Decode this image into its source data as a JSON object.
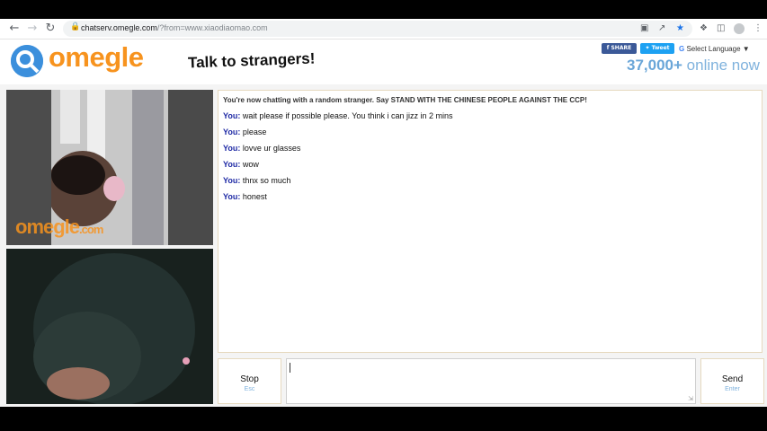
{
  "browser": {
    "url_host": "chatserv.omegle.com",
    "url_rest": "/?from=www.xiaodiaomao.com",
    "icons": {
      "back": "arrow-left-icon",
      "forward": "arrow-right-icon",
      "reload": "reload-icon",
      "lock": "lock-icon",
      "camera": "camera-icon",
      "share": "share-icon",
      "bookmark": "star-icon",
      "extensions": "puzzle-icon",
      "sidepanel": "side-panel-icon",
      "profile": "profile-icon",
      "menu": "kebab-menu-icon"
    }
  },
  "header": {
    "logo_text": "omegle",
    "tagline": "Talk to strangers!",
    "fb_label": "SHARE",
    "tw_label": "Tweet",
    "language_label": "Select Language",
    "online_count": "37,000+",
    "online_label": "online now"
  },
  "video": {
    "watermark_main": "omegle",
    "watermark_suffix": ".com"
  },
  "chat": {
    "status": "You're now chatting with a random stranger. Say STAND WITH THE CHINESE PEOPLE AGAINST THE CCP!",
    "messages": [
      {
        "who": "You:",
        "text": "wait please if possible please. You think i can jizz in 2 mins"
      },
      {
        "who": "You:",
        "text": "please"
      },
      {
        "who": "You:",
        "text": "lovve ur glasses"
      },
      {
        "who": "You:",
        "text": "wow"
      },
      {
        "who": "You:",
        "text": "thnx so much"
      },
      {
        "who": "You:",
        "text": "honest"
      }
    ]
  },
  "controls": {
    "stop_label": "Stop",
    "stop_hint": "Esc",
    "send_label": "Send",
    "send_hint": "Enter"
  },
  "colors": {
    "accent_orange": "#f7931e",
    "accent_blue": "#3b8fdc",
    "you_label": "#1f2aa5"
  }
}
